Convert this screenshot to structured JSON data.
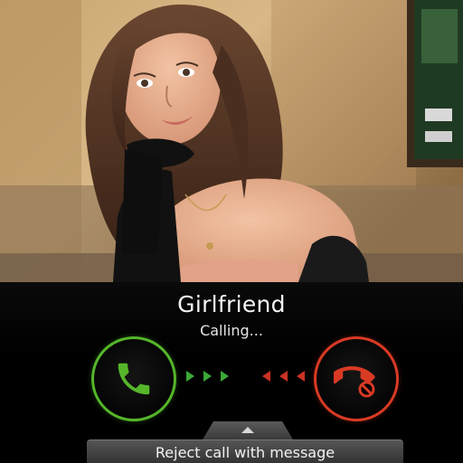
{
  "caller": {
    "name": "Girlfriend",
    "status": "Calling..."
  },
  "actions": {
    "reject_with_message": "Reject call with message"
  },
  "icons": {
    "answer": "phone-answer-icon",
    "decline": "phone-decline-icon",
    "swipe_hint": "chevron-up-icon"
  },
  "colors": {
    "answer": "#55b62a",
    "decline": "#d93a24",
    "answer_arrows": "#3aa836",
    "decline_arrows": "#c83224"
  }
}
